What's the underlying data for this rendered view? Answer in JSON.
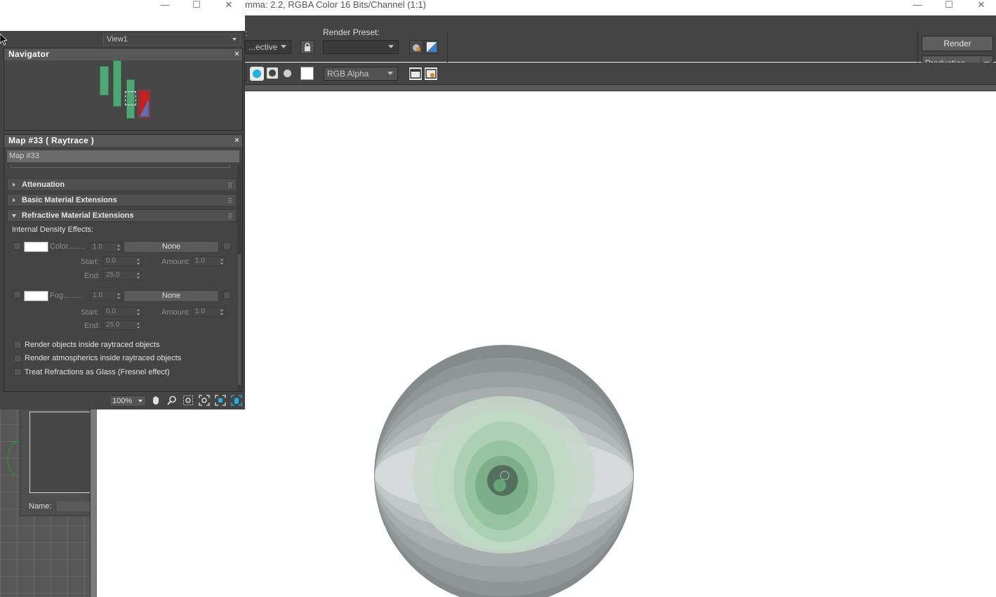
{
  "render_window": {
    "title": "mma: 2.2, RGBA Color 16 Bits/Channel (1:1)",
    "viewport_dropdown_value": "...ective",
    "area_label_tail": ":",
    "render_preset_label": "Render Preset:",
    "render_preset_value": "",
    "channel_dropdown_value": "RGB Alpha",
    "render_button": "Render",
    "production_dropdown_value": "Production",
    "minimize_glyph": "—",
    "maximize_glyph": "☐",
    "close_glyph": "✕"
  },
  "slate_editor": {
    "minimize_glyph": "—",
    "maximize_glyph": "☐",
    "close_glyph": "✕",
    "view_dropdown_value": "View1",
    "navigator": {
      "title": "Navigator",
      "close_glyph": "×"
    },
    "map_panel": {
      "title": "Map #33  ( Raytrace )",
      "close_glyph": "×",
      "name_field_value": "Map #33",
      "rollouts": {
        "attenuation": "Attenuation",
        "basic_material_extensions": "Basic Material Extensions",
        "refractive_material_extensions": "Refractive Material Extensions"
      },
      "internal_density_label": "Internal Density Effects:",
      "color_row": {
        "label": "Color........",
        "amount_value": "1.0",
        "map_button": "None",
        "start_label": "Start:",
        "start_value": "0.0",
        "end_label": "End:",
        "end_value": "25.0",
        "amount_label": "Amount:",
        "amount2_value": "1.0"
      },
      "fog_row": {
        "label": "Fog.........",
        "amount_value": "1.0",
        "map_button": "None",
        "start_label": "Start:",
        "start_value": "0.0",
        "end_label": "End:",
        "end_value": "25.0",
        "amount_label": "Amount:",
        "amount2_value": "1.0"
      },
      "checkboxes": [
        "Render objects inside raytraced objects",
        "Render atmospherics inside raytraced objects",
        "Treat Refractions as Glass (Fresnel effect)"
      ]
    },
    "statusbar": {
      "zoom_value": "100%"
    }
  },
  "viewport": {
    "name_label": "Name:"
  },
  "colors": {
    "panel_bg": "#444444",
    "node_green": "#4da873",
    "accent_cyan": "#1fb3e0"
  }
}
